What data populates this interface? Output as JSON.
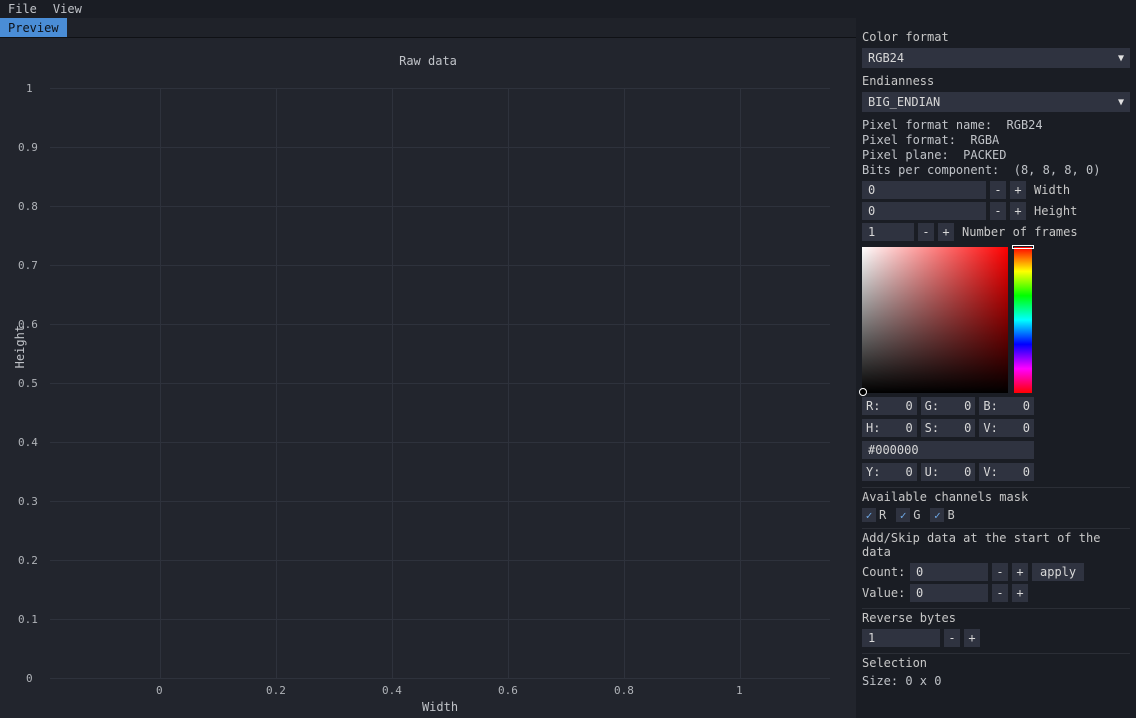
{
  "menu": {
    "file": "File",
    "view": "View"
  },
  "tab": {
    "preview": "Preview"
  },
  "chart": {
    "title": "Raw data",
    "xlabel": "Width",
    "ylabel": "Height",
    "xticks": [
      "0",
      "0.2",
      "0.4",
      "0.6",
      "0.8",
      "1"
    ],
    "yticks": [
      "0",
      "0.1",
      "0.2",
      "0.3",
      "0.4",
      "0.5",
      "0.6",
      "0.7",
      "0.8",
      "0.9",
      "1"
    ]
  },
  "chart_data": {
    "type": "scatter",
    "title": "Raw data",
    "xlabel": "Width",
    "ylabel": "Height",
    "xlim": [
      0,
      1
    ],
    "ylim": [
      0,
      1
    ],
    "x": [],
    "y": []
  },
  "panel": {
    "color_format_label": "Color format",
    "color_format_value": "RGB24",
    "endianness_label": "Endianness",
    "endianness_value": "BIG_ENDIAN",
    "info_pixel_format_name": "Pixel format name:  RGB24",
    "info_pixel_format": "Pixel format:  RGBA",
    "info_pixel_plane": "Pixel plane:  PACKED",
    "info_bits": "Bits per component:  (8, 8, 8, 0)",
    "width_value": "0",
    "width_label": "Width",
    "height_value": "0",
    "height_label": "Height",
    "frames_value": "1",
    "frames_label": "Number of frames",
    "minus": "-",
    "plus": "+",
    "rgb": {
      "r_lbl": "R:",
      "r_val": "0",
      "g_lbl": "G:",
      "g_val": "0",
      "b_lbl": "B:",
      "b_val": "0"
    },
    "hsv": {
      "h_lbl": "H:",
      "h_val": "0",
      "s_lbl": "S:",
      "s_val": "0",
      "v_lbl": "V:",
      "v_val": "0"
    },
    "hex": "#000000",
    "yuv": {
      "y_lbl": "Y:",
      "y_val": "0",
      "u_lbl": "U:",
      "u_val": "0",
      "v_lbl": "V:",
      "v_val": "0"
    },
    "mask_label": "Available channels mask",
    "chk_r": "R",
    "chk_g": "G",
    "chk_b": "B",
    "addskip_label": "Add/Skip data at the start of the data",
    "count_label": "Count:",
    "count_value": "0",
    "value_label": "Value:",
    "value_value": "0",
    "apply": "apply",
    "reverse_label": "Reverse bytes",
    "reverse_value": "1",
    "selection_label": "Selection",
    "selection_size": "Size: 0 x 0"
  }
}
